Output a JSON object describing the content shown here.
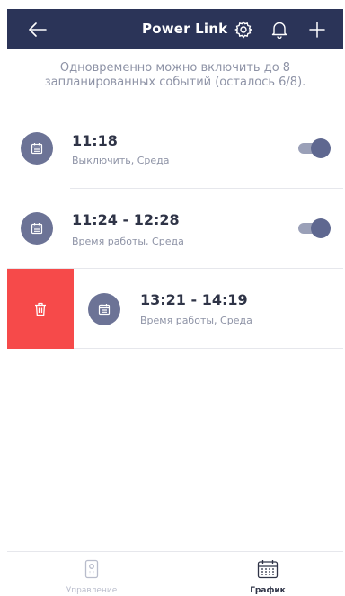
{
  "header": {
    "title": "Power Link",
    "back_icon": "arrow-left-icon",
    "settings_icon": "gear-icon",
    "notifications_icon": "bell-icon",
    "add_icon": "plus-icon",
    "background": "#2b3458"
  },
  "info_text": "Одновременно можно включить до 8 запланированных событий (осталось 6/8).",
  "schedule": [
    {
      "time": "11:18",
      "description": "Выключить, Среда",
      "enabled": true,
      "icon": "calendar-icon"
    },
    {
      "time": "11:24 - 12:28",
      "description": "Время работы, Среда",
      "enabled": true,
      "icon": "calendar-icon"
    },
    {
      "time": "13:21 - 14:19",
      "description": "Время работы, Среда",
      "swiped": true,
      "icon": "calendar-icon"
    }
  ],
  "delete_action": {
    "icon": "trash-icon",
    "color": "#f64a4a"
  },
  "tabs": [
    {
      "label": "Управление",
      "icon": "remote-icon",
      "active": false
    },
    {
      "label": "График",
      "icon": "calendar-grid-icon",
      "active": true
    }
  ],
  "colors": {
    "accent": "#2b3458",
    "icon_circle": "#6c7396",
    "toggle_on": "#5f6890",
    "muted_text": "#8e93a6",
    "danger": "#f64a4a"
  }
}
